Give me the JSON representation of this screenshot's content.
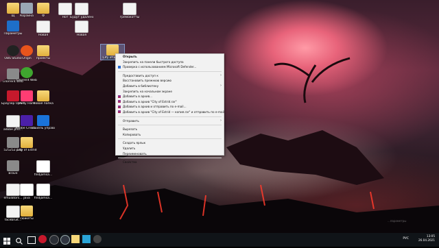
{
  "desktop_icons": [
    {
      "label": "Щ",
      "x": "5",
      "y": "4"
    },
    {
      "label": "Корзина",
      "x": "5",
      "y": "4"
    },
    {
      "label": "Ф",
      "x": "5",
      "y": "4"
    },
    {
      "label": "Нот",
      "x": "5",
      "y": "4"
    },
    {
      "label": "Будут\nудалены",
      "x": "5",
      "y": "4"
    },
    {
      "label": "гремокотты",
      "x": "5",
      "y": "4"
    },
    {
      "label": "Параметры",
      "x": "5",
      "y": "4"
    },
    {
      "label": "Новая",
      "x": "5",
      "y": "4"
    },
    {
      "label": "OBS Studio",
      "x": "5",
      "y": "4"
    },
    {
      "label": "Origin",
      "x": "5",
      "y": "4"
    },
    {
      "label": "проекты",
      "x": "5",
      "y": "4"
    },
    {
      "label": "uTorrent Web",
      "x": "5",
      "y": "4"
    },
    {
      "label": "Браузер Opera GX",
      "x": "5",
      "y": "4"
    },
    {
      "label": "Party Hard",
      "x": "5",
      "y": "4"
    },
    {
      "label": "Новая папка",
      "x": "5",
      "y": "4"
    },
    {
      "label": "adobe pho...",
      "x": "5",
      "y": "4"
    },
    {
      "label": "Adobe Creati...",
      "x": "5",
      "y": "4"
    },
    {
      "label": "Панель управления",
      "x": "5",
      "y": "4"
    },
    {
      "label": "525252.png",
      "x": "5",
      "y": "4"
    },
    {
      "label": "City of Estrid",
      "x": "5",
      "y": "4"
    },
    {
      "label": "Brave",
      "x": "5",
      "y": "4"
    },
    {
      "label": "findjamsa...",
      "x": "5",
      "y": "4"
    },
    {
      "label": "emulators...",
      "x": "5",
      "y": "4"
    },
    {
      "label": "Java",
      "x": "5",
      "y": "4"
    },
    {
      "label": "facebruit...",
      "x": "5",
      "y": "4"
    },
    {
      "label": "сюжеты",
      "x": "5",
      "y": "4"
    },
    {
      "label": "City of Estrid",
      "x": "5",
      "y": "4"
    }
  ],
  "context_menu": {
    "items": [
      {
        "label": "Открыть",
        "bold": true
      },
      {
        "label": "Закрепить на панели быстрого доступа"
      },
      {
        "label": "Проверка с использованием Microsoft Defender...",
        "icon": "defender-icon"
      },
      {
        "sep": true
      },
      {
        "label": "Предоставить доступ к",
        "submenu": true
      },
      {
        "label": "Восстановить прежнюю версию"
      },
      {
        "label": "Добавить в библиотеку",
        "submenu": true
      },
      {
        "label": "Закрепить на начальном экране"
      },
      {
        "label": "Добавить в архив...",
        "icon": "winrar-icon"
      },
      {
        "label": "Добавить в архив \"City of Estrid.rar\"",
        "icon": "winrar-icon"
      },
      {
        "label": "Добавить в архив и отправить по e-mail...",
        "icon": "winrar-icon"
      },
      {
        "label": "Добавить в архив \"City of Estrid — копия.rar\" и отправить по e-mail",
        "icon": "winrar-icon"
      },
      {
        "sep": true
      },
      {
        "label": "Отправить",
        "submenu": true
      },
      {
        "sep": true
      },
      {
        "label": "Вырезать"
      },
      {
        "label": "Копировать"
      },
      {
        "sep": true
      },
      {
        "label": "Создать ярлык"
      },
      {
        "label": "Удалить"
      },
      {
        "label": "Переименовать"
      },
      {
        "sep": true
      },
      {
        "label": "Свойства"
      }
    ]
  },
  "taskbar": {
    "language": "РУС",
    "time": "13:05",
    "date": "26.04.2021"
  },
  "watermark": "...параметры"
}
